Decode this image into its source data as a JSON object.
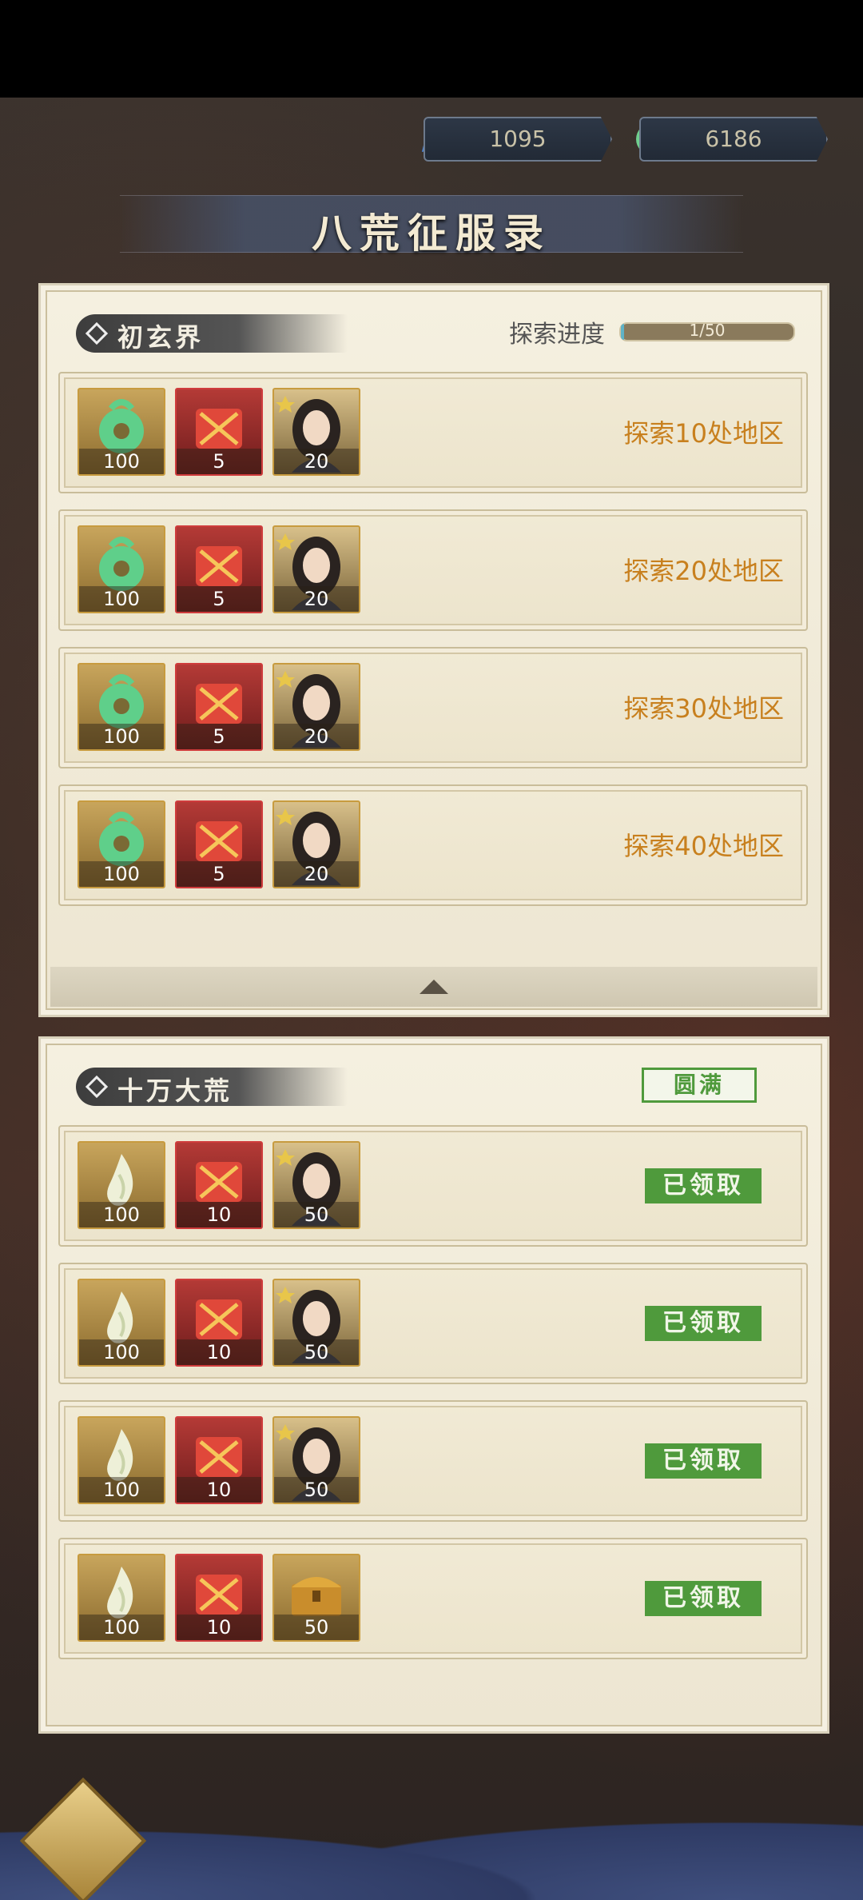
{
  "status_bar": {},
  "resources": {
    "crystal": {
      "icon": "blue-crystal-icon",
      "value": "1095"
    },
    "jade": {
      "icon": "jade-coin-icon",
      "value": "6186"
    }
  },
  "page_title": "八荒征服录",
  "section1": {
    "name": "初玄界",
    "progress_label": "探索进度",
    "progress_text": "1/50",
    "progress_fraction": 0.02,
    "rows": [
      {
        "items": [
          {
            "type": "jade",
            "qty": "100"
          },
          {
            "type": "red-gift",
            "qty": "5"
          },
          {
            "type": "portrait",
            "qty": "20"
          }
        ],
        "task": "探索10处地区"
      },
      {
        "items": [
          {
            "type": "jade",
            "qty": "100"
          },
          {
            "type": "red-gift",
            "qty": "5"
          },
          {
            "type": "portrait",
            "qty": "20"
          }
        ],
        "task": "探索20处地区"
      },
      {
        "items": [
          {
            "type": "jade",
            "qty": "100"
          },
          {
            "type": "red-gift",
            "qty": "5"
          },
          {
            "type": "portrait",
            "qty": "20"
          }
        ],
        "task": "探索30处地区"
      },
      {
        "items": [
          {
            "type": "jade",
            "qty": "100"
          },
          {
            "type": "red-gift",
            "qty": "5"
          },
          {
            "type": "portrait",
            "qty": "20"
          }
        ],
        "task": "探索40处地区"
      }
    ]
  },
  "section2": {
    "name": "十万大荒",
    "badge": "圆满",
    "rows": [
      {
        "items": [
          {
            "type": "flame",
            "qty": "100"
          },
          {
            "type": "red-gift",
            "qty": "10"
          },
          {
            "type": "portrait",
            "qty": "50"
          }
        ],
        "status": "已领取"
      },
      {
        "items": [
          {
            "type": "flame",
            "qty": "100"
          },
          {
            "type": "red-gift",
            "qty": "10"
          },
          {
            "type": "portrait",
            "qty": "50"
          }
        ],
        "status": "已领取"
      },
      {
        "items": [
          {
            "type": "flame",
            "qty": "100"
          },
          {
            "type": "red-gift",
            "qty": "10"
          },
          {
            "type": "portrait",
            "qty": "50"
          }
        ],
        "status": "已领取"
      },
      {
        "items": [
          {
            "type": "flame",
            "qty": "100"
          },
          {
            "type": "red-gift",
            "qty": "10"
          },
          {
            "type": "chest",
            "qty": "50"
          }
        ],
        "status": "已领取"
      }
    ]
  },
  "colors": {
    "task_text": "#c8801e",
    "claimed_bg": "#4f9a3c",
    "progress_fill": "#5fb3c7"
  }
}
